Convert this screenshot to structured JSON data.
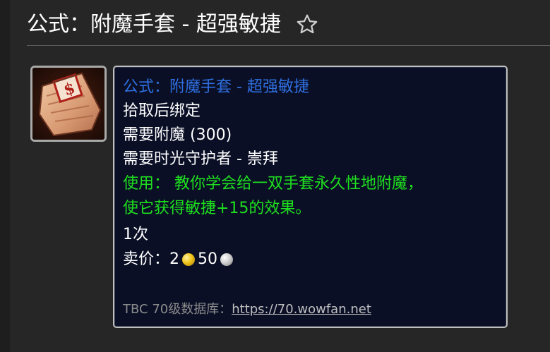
{
  "header": {
    "title": "公式：附魔手套 - 超强敏捷",
    "favorite_icon": "star-outline-icon"
  },
  "item": {
    "icon_name": "formula-scroll-icon",
    "name": "公式：附魔手套 - 超强敏捷",
    "name_color": "#2f6fe0",
    "bind": "拾取后绑定",
    "requires_skill": "需要附魔 (300)",
    "requires_rep": "需要时光守护者 - 崇拜",
    "use_line1": "使用： 教你学会给一双手套永久性地附魔，",
    "use_line2": "使它获得敏捷+15的效果。",
    "use_color": "#1ee01e",
    "charges": "1次",
    "sell_label": "卖价：",
    "sell_gold": "2",
    "sell_silver": "50",
    "footer_label": "TBC 70级数据库：",
    "footer_link": "https://70.wowfan.net"
  }
}
